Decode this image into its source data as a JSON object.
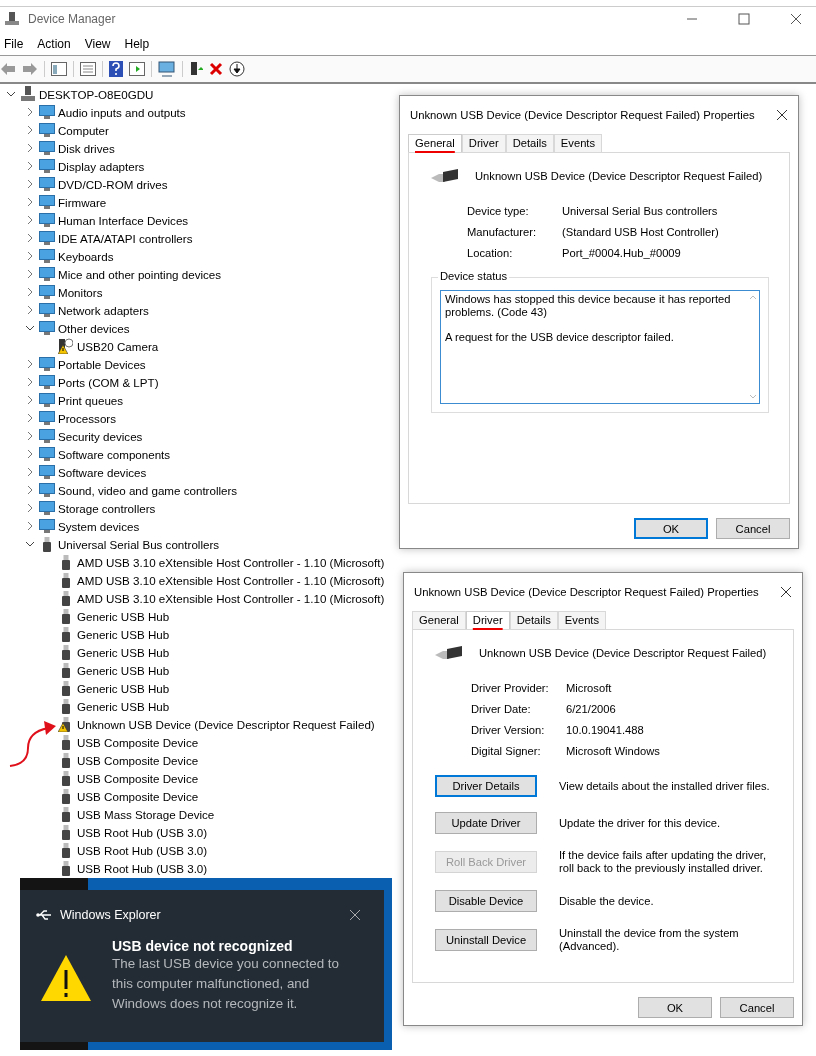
{
  "window": {
    "title": "Device Manager",
    "menu": [
      "File",
      "Action",
      "View",
      "Help"
    ]
  },
  "device_tree": [
    {
      "label": "DESKTOP-O8E0GDU",
      "kind": "computer",
      "expanded": true,
      "children": [
        {
          "label": "Audio inputs and outputs",
          "kind": "category",
          "expanded": false
        },
        {
          "label": "Computer",
          "kind": "category",
          "expanded": false
        },
        {
          "label": "Disk drives",
          "kind": "category",
          "expanded": false
        },
        {
          "label": "Display adapters",
          "kind": "category",
          "expanded": false
        },
        {
          "label": "DVD/CD-ROM drives",
          "kind": "category",
          "expanded": false
        },
        {
          "label": "Firmware",
          "kind": "category",
          "expanded": false
        },
        {
          "label": "Human Interface Devices",
          "kind": "category",
          "expanded": false
        },
        {
          "label": "IDE ATA/ATAPI controllers",
          "kind": "category",
          "expanded": false
        },
        {
          "label": "Keyboards",
          "kind": "category",
          "expanded": false
        },
        {
          "label": "Mice and other pointing devices",
          "kind": "category",
          "expanded": false
        },
        {
          "label": "Monitors",
          "kind": "category",
          "expanded": false
        },
        {
          "label": "Network adapters",
          "kind": "category",
          "expanded": false
        },
        {
          "label": "Other devices",
          "kind": "category",
          "expanded": true,
          "children": [
            {
              "label": "USB20 Camera",
              "kind": "unknown_device",
              "warning": true
            }
          ]
        },
        {
          "label": "Portable Devices",
          "kind": "category",
          "expanded": false
        },
        {
          "label": "Ports (COM & LPT)",
          "kind": "category",
          "expanded": false
        },
        {
          "label": "Print queues",
          "kind": "category",
          "expanded": false
        },
        {
          "label": "Processors",
          "kind": "category",
          "expanded": false
        },
        {
          "label": "Security devices",
          "kind": "category",
          "expanded": false
        },
        {
          "label": "Software components",
          "kind": "category",
          "expanded": false
        },
        {
          "label": "Software devices",
          "kind": "category",
          "expanded": false
        },
        {
          "label": "Sound, video and game controllers",
          "kind": "category",
          "expanded": false
        },
        {
          "label": "Storage controllers",
          "kind": "category",
          "expanded": false
        },
        {
          "label": "System devices",
          "kind": "category",
          "expanded": false
        },
        {
          "label": "Universal Serial Bus controllers",
          "kind": "usb_category",
          "expanded": true,
          "children": [
            {
              "label": "AMD USB 3.10 eXtensible Host Controller - 1.10 (Microsoft)",
              "kind": "usb",
              "warning": false
            },
            {
              "label": "AMD USB 3.10 eXtensible Host Controller - 1.10 (Microsoft)",
              "kind": "usb",
              "warning": false
            },
            {
              "label": "AMD USB 3.10 eXtensible Host Controller - 1.10 (Microsoft)",
              "kind": "usb",
              "warning": false
            },
            {
              "label": "Generic USB Hub",
              "kind": "usb",
              "warning": false
            },
            {
              "label": "Generic USB Hub",
              "kind": "usb",
              "warning": false
            },
            {
              "label": "Generic USB Hub",
              "kind": "usb",
              "warning": false
            },
            {
              "label": "Generic USB Hub",
              "kind": "usb",
              "warning": false
            },
            {
              "label": "Generic USB Hub",
              "kind": "usb",
              "warning": false
            },
            {
              "label": "Generic USB Hub",
              "kind": "usb",
              "warning": false
            },
            {
              "label": "Unknown USB Device (Device Descriptor Request Failed)",
              "kind": "usb",
              "warning": true
            },
            {
              "label": "USB Composite Device",
              "kind": "usb",
              "warning": false
            },
            {
              "label": "USB Composite Device",
              "kind": "usb",
              "warning": false
            },
            {
              "label": "USB Composite Device",
              "kind": "usb",
              "warning": false
            },
            {
              "label": "USB Composite Device",
              "kind": "usb",
              "warning": false
            },
            {
              "label": "USB Mass Storage Device",
              "kind": "usb",
              "warning": false
            },
            {
              "label": "USB Root Hub (USB 3.0)",
              "kind": "usb",
              "warning": false
            },
            {
              "label": "USB Root Hub (USB 3.0)",
              "kind": "usb",
              "warning": false
            },
            {
              "label": "USB Root Hub (USB 3.0)",
              "kind": "usb",
              "warning": false
            }
          ]
        }
      ]
    }
  ],
  "general_dialog": {
    "title": "Unknown USB Device (Device Descriptor Request Failed) Properties",
    "tabs": [
      {
        "label": "General",
        "selected": true
      },
      {
        "label": "Driver",
        "selected": false
      },
      {
        "label": "Details",
        "selected": false
      },
      {
        "label": "Events",
        "selected": false
      }
    ],
    "device_name": "Unknown USB Device (Device Descriptor Request Failed)",
    "properties": [
      {
        "label": "Device type:",
        "value": "Universal Serial Bus controllers"
      },
      {
        "label": "Manufacturer:",
        "value": "(Standard USB Host Controller)"
      },
      {
        "label": "Location:",
        "value": "Port_#0004.Hub_#0009"
      }
    ],
    "status_label": "Device status",
    "status_text": [
      "Windows has stopped this device because it has reported problems. (Code 43)",
      "A request for the USB device descriptor failed."
    ],
    "buttons": [
      {
        "label": "OK",
        "default": true
      },
      {
        "label": "Cancel",
        "default": false
      }
    ]
  },
  "driver_dialog": {
    "title": "Unknown USB Device (Device Descriptor Request Failed) Properties",
    "tabs": [
      {
        "label": "General",
        "selected": false
      },
      {
        "label": "Driver",
        "selected": true
      },
      {
        "label": "Details",
        "selected": false
      },
      {
        "label": "Events",
        "selected": false
      }
    ],
    "device_name": "Unknown USB Device (Device Descriptor Request Failed)",
    "properties": [
      {
        "label": "Driver Provider:",
        "value": "Microsoft"
      },
      {
        "label": "Driver Date:",
        "value": "6/21/2006"
      },
      {
        "label": "Driver Version:",
        "value": "10.0.19041.488"
      },
      {
        "label": "Digital Signer:",
        "value": "Microsoft Windows"
      }
    ],
    "actions": [
      {
        "button": "Driver Details",
        "description": "View details about the installed driver files.",
        "disabled": false,
        "focused": true
      },
      {
        "button": "Update Driver",
        "description": "Update the driver for this device.",
        "disabled": false,
        "focused": false
      },
      {
        "button": "Roll Back Driver",
        "description": "If the device fails after updating the driver, roll back to the previously installed driver.",
        "disabled": true,
        "focused": false
      },
      {
        "button": "Disable Device",
        "description": "Disable the device.",
        "disabled": false,
        "focused": false
      },
      {
        "button": "Uninstall Device",
        "description": "Uninstall the device from the system (Advanced).",
        "disabled": false,
        "focused": false
      }
    ],
    "buttons": [
      {
        "label": "OK",
        "default": false
      },
      {
        "label": "Cancel",
        "default": false
      }
    ]
  },
  "notification": {
    "app": "Windows Explorer",
    "title": "USB device not recognized",
    "message": "The last USB device you connected to this computer malfunctioned, and Windows does not recognize it."
  }
}
